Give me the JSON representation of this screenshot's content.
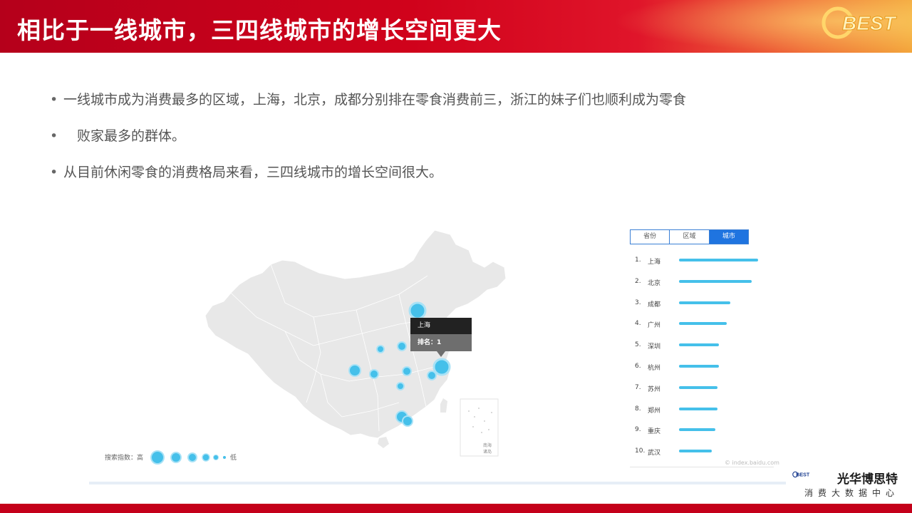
{
  "header": {
    "title": "相比于一线城市，三四线城市的增长空间更大",
    "logo_text": "BEST"
  },
  "bullets": [
    {
      "marker": "•",
      "text": "一线城市成为消费最多的区域，上海，北京，成都分别排在零食消费前三，浙江的妹子们也顺利成为零食"
    },
    {
      "marker": "•",
      "text": "败家最多的群体。"
    },
    {
      "marker": "•",
      "text": "从目前休闲零食的消费格局来看，三四线城市的增长空间很大。"
    }
  ],
  "map": {
    "inset_label_line1": "南海",
    "inset_label_line2": "诸岛",
    "legend_label": "搜索指数：高",
    "legend_low": "低",
    "tooltip": {
      "city": "上海",
      "rank_text": "排名：1"
    }
  },
  "tabs": [
    {
      "label": "省份",
      "active": false
    },
    {
      "label": "区域",
      "active": false
    },
    {
      "label": "城市",
      "active": true
    }
  ],
  "ranking": [
    {
      "num": "1.",
      "city": "上海",
      "value": 1.0
    },
    {
      "num": "2.",
      "city": "北京",
      "value": 0.92
    },
    {
      "num": "3.",
      "city": "成都",
      "value": 0.65
    },
    {
      "num": "4.",
      "city": "广州",
      "value": 0.6
    },
    {
      "num": "5.",
      "city": "深圳",
      "value": 0.5
    },
    {
      "num": "6.",
      "city": "杭州",
      "value": 0.5
    },
    {
      "num": "7.",
      "city": "苏州",
      "value": 0.49
    },
    {
      "num": "8.",
      "city": "郑州",
      "value": 0.49
    },
    {
      "num": "9.",
      "city": "重庆",
      "value": 0.46
    },
    {
      "num": "10.",
      "city": "武汉",
      "value": 0.41
    }
  ],
  "credit": "© index.baidu.com",
  "brand": {
    "name": "光华博思特",
    "subtitle": "消费大数据中心",
    "logo_text": "BEST"
  },
  "colors": {
    "header_red": "#d0021b",
    "bubble_blue": "#45c0ea",
    "tab_active": "#1f74e0",
    "footer_red": "#c4001a"
  }
}
